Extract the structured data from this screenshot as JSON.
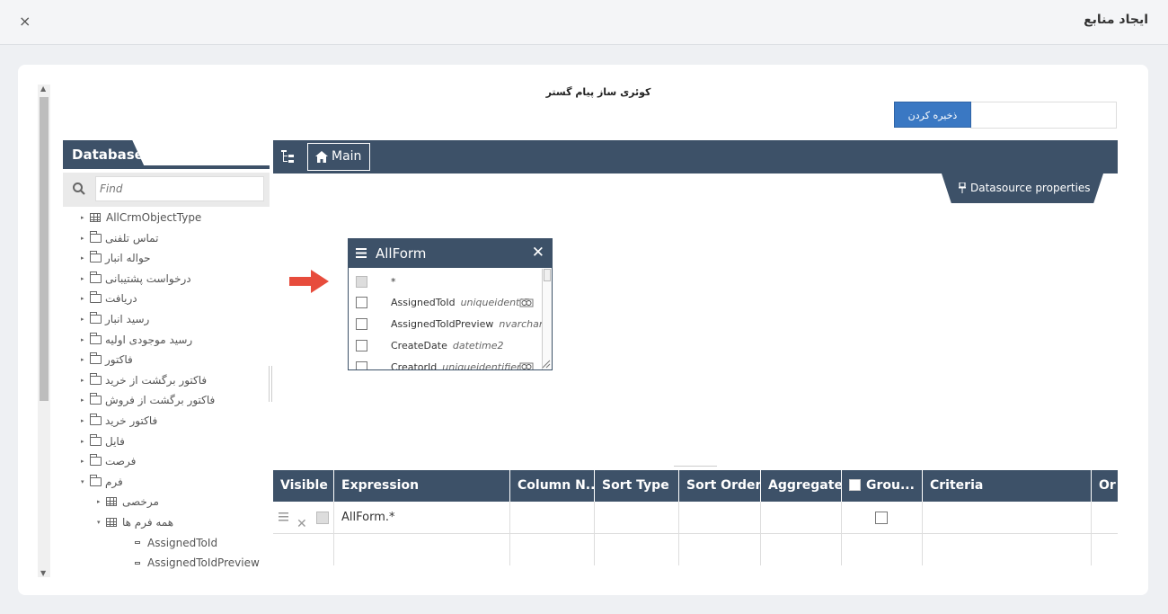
{
  "modal": {
    "title": "ایجاد منابع",
    "close_glyph": "×"
  },
  "builder": {
    "title": "کوئری ساز پیام گستر",
    "save_label": "ذخیره کردن",
    "save_input_value": ""
  },
  "database": {
    "tab_label": "Database",
    "search_placeholder": "Find",
    "tree": [
      {
        "label": "AllCrmObjectType",
        "kind": "table",
        "arrow": "▸"
      },
      {
        "label": "تماس تلفنی",
        "kind": "folder",
        "arrow": "▸"
      },
      {
        "label": "حواله انبار",
        "kind": "folder",
        "arrow": "▸"
      },
      {
        "label": "درخواست پشتیبانی",
        "kind": "folder",
        "arrow": "▸"
      },
      {
        "label": "دریافت",
        "kind": "folder",
        "arrow": "▸"
      },
      {
        "label": "رسید انبار",
        "kind": "folder",
        "arrow": "▸"
      },
      {
        "label": "رسید موجودی اولیه",
        "kind": "folder",
        "arrow": "▸"
      },
      {
        "label": "فاکتور",
        "kind": "folder",
        "arrow": "▸"
      },
      {
        "label": "فاکتور برگشت از خرید",
        "kind": "folder",
        "arrow": "▸"
      },
      {
        "label": "فاکتور برگشت از فروش",
        "kind": "folder",
        "arrow": "▸"
      },
      {
        "label": "فاکتور خرید",
        "kind": "folder",
        "arrow": "▸"
      },
      {
        "label": "فایل",
        "kind": "folder",
        "arrow": "▸"
      },
      {
        "label": "فرصت",
        "kind": "folder",
        "arrow": "▸"
      },
      {
        "label": "فرم",
        "kind": "folder",
        "arrow": "▾"
      },
      {
        "label": "مرخصی",
        "kind": "table",
        "arrow": "▸"
      },
      {
        "label": "همه فرم ها",
        "kind": "table",
        "arrow": "▾"
      },
      {
        "label": "AssignedToId",
        "kind": "field",
        "arrow": ""
      },
      {
        "label": "AssignedToIdPreview",
        "kind": "field",
        "arrow": ""
      }
    ]
  },
  "main": {
    "crumb_label": "Main",
    "datasource_label": "Datasource properties"
  },
  "allform": {
    "title": "AllForm",
    "close_glyph": "✕",
    "fields": [
      {
        "name": "*",
        "type": "",
        "checked": true,
        "link": false
      },
      {
        "name": "AssignedToId",
        "type": "uniqueidentifi",
        "checked": false,
        "link": true
      },
      {
        "name": "AssignedToIdPreview",
        "type": "nvarchar",
        "checked": false,
        "link": false
      },
      {
        "name": "CreateDate",
        "type": "datetime2",
        "checked": false,
        "link": false
      },
      {
        "name": "CreatorId",
        "type": "uniqueidentifier",
        "checked": false,
        "link": true
      }
    ]
  },
  "grid": {
    "headers": [
      "Visible",
      "Expression",
      "Column N...",
      "Sort Type",
      "Sort Order",
      "Aggregate",
      "Grou...",
      "Criteria",
      "Or"
    ],
    "rows": [
      {
        "expression": "AllForm.*"
      },
      {
        "expression": ""
      }
    ],
    "delete_glyph": "✕"
  },
  "colors": {
    "header_bg": "#3d5168",
    "save_button": "#3a78c3",
    "arrow": "#e74c3c"
  }
}
